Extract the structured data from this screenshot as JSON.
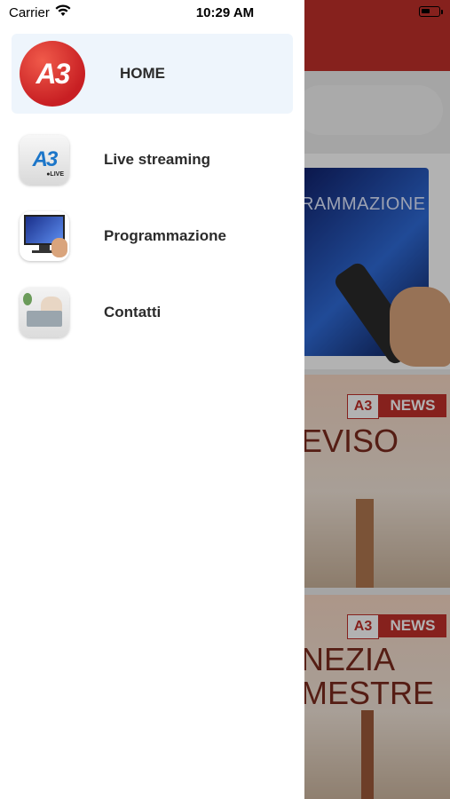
{
  "status_bar": {
    "carrier": "Carrier",
    "time": "10:29 AM",
    "wifi_icon": "wifi-icon",
    "battery_icon": "battery-icon"
  },
  "drawer": {
    "items": [
      {
        "label": "HOME",
        "icon": "a3-logo-icon",
        "active": true
      },
      {
        "label": "Live streaming",
        "icon": "live-streaming-icon",
        "active": false
      },
      {
        "label": "Programmazione",
        "icon": "tv-schedule-icon",
        "active": false
      },
      {
        "label": "Contatti",
        "icon": "contact-icon",
        "active": false
      }
    ]
  },
  "background": {
    "card1_text": "RAMMAZIONE",
    "card2_badge": "NEWS",
    "card2_city": "EVISO",
    "card3_badge": "NEWS",
    "card3_city_line1": "NEZIA",
    "card3_city_line2": "MESTRE"
  },
  "colors": {
    "brand_red": "#c0302a",
    "active_item_bg": "#eef5fc",
    "label_text": "#2b2b2b"
  }
}
